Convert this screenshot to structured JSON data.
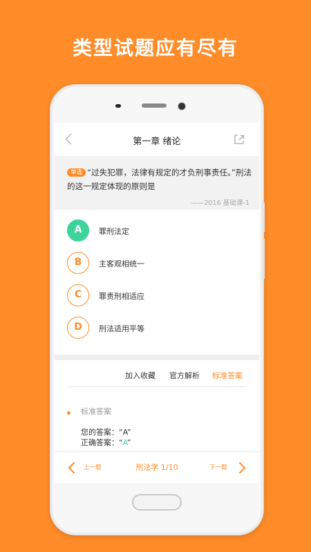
{
  "headline": "类型试题应有尽有",
  "nav": {
    "title": "第一章 绪论"
  },
  "question": {
    "tag": "单选",
    "text": "“过失犯罪，法律有规定的才负刑事责任。”刑法的这一规定体现的原则是",
    "source": "——2016 基础课-1"
  },
  "options": [
    {
      "letter": "A",
      "label": "罪刑法定",
      "selected": true
    },
    {
      "letter": "B",
      "label": "主客观相统一",
      "selected": false
    },
    {
      "letter": "C",
      "label": "罪责刑相适应",
      "selected": false
    },
    {
      "letter": "D",
      "label": "刑法适用平等",
      "selected": false
    }
  ],
  "actions": {
    "favorite": "加入收藏",
    "analysis": "官方解析",
    "standard": "标准答案"
  },
  "answer": {
    "title": "标准答案",
    "your_label": "您的答案：“A”",
    "correct_prefix": "正确答案：“",
    "correct_value": "A",
    "correct_suffix": "”"
  },
  "bottom": {
    "prev": "上一题",
    "progress": "刑法学 1/10",
    "next": "下一题"
  },
  "colors": {
    "accent": "#FF8C28",
    "correct": "#3DD49C"
  },
  "icons": [
    "back-chevron-icon",
    "share-icon",
    "prev-chevron-icon",
    "next-chevron-icon"
  ]
}
